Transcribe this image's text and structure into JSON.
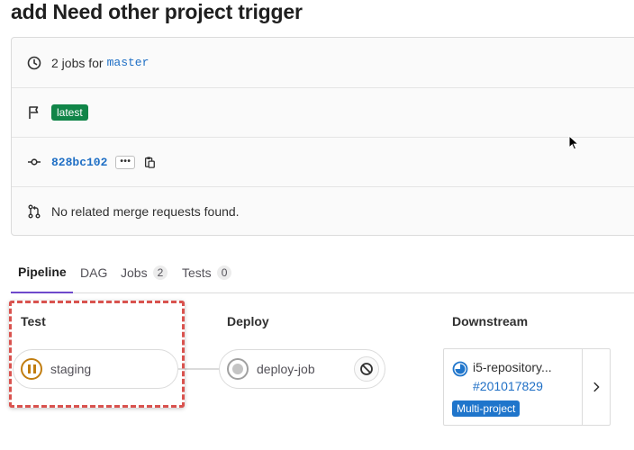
{
  "page": {
    "title": "add Need other project trigger"
  },
  "info": {
    "jobs_text": "2 jobs for",
    "branch": "master",
    "latest_badge": "latest",
    "commit_sha": "828bc102",
    "ellipsis": "•••",
    "merge_requests": "No related merge requests found."
  },
  "tabs": [
    {
      "label": "Pipeline"
    },
    {
      "label": "DAG"
    },
    {
      "label": "Jobs",
      "count": "2"
    },
    {
      "label": "Tests",
      "count": "0"
    }
  ],
  "stages": [
    {
      "name": "Test",
      "jobs": [
        {
          "name": "staging",
          "status": "manual"
        }
      ]
    },
    {
      "name": "Deploy",
      "jobs": [
        {
          "name": "deploy-job",
          "status": "created"
        }
      ]
    },
    {
      "name": "Downstream",
      "downstream": {
        "project": "i5-repository...",
        "pipeline_id": "#201017829",
        "badge": "Multi-project",
        "status": "running"
      }
    }
  ],
  "colors": {
    "active_tab": "#6e49cb",
    "manual": "#c17d10",
    "link": "#1f6fc5",
    "success": "#108548",
    "highlight": "#d9534f"
  }
}
